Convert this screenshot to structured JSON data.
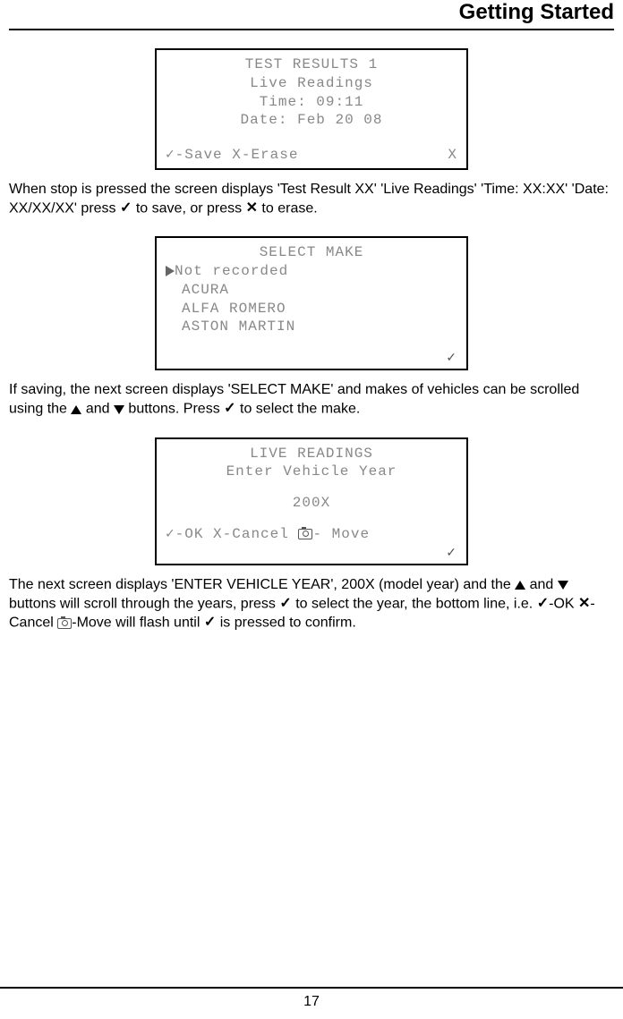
{
  "header": {
    "title": "Getting Started"
  },
  "lcd1": {
    "l1": "TEST RESULTS 1",
    "l2": "Live Readings",
    "l3": "Time: 09:11",
    "l4": "Date: Feb 20 08",
    "footer_left": "✓-Save   X-Erase",
    "footer_right": "X"
  },
  "para1": {
    "t1": "When stop is pressed the screen displays 'Test Result XX' 'Live Readings' 'Time: XX:XX' 'Date: XX/XX/XX' press ",
    "t2": " to save, or press ",
    "t3": " to erase."
  },
  "lcd2": {
    "title": "SELECT MAKE",
    "item0": "Not recorded",
    "item1": "ACURA",
    "item2": "ALFA ROMERO",
    "item3": "ASTON MARTIN",
    "footer": "✓"
  },
  "para2": {
    "t1": "If saving, the next screen displays 'SELECT MAKE' and makes of vehicles can be scrolled using the ",
    "t2": " and ",
    "t3": " buttons. Press ",
    "t4": " to select the make."
  },
  "lcd3": {
    "l1": "LIVE READINGS",
    "l2": "Enter Vehicle Year",
    "l3": "200X",
    "footer_left1": "✓-OK X-Cancel ",
    "footer_left2": "- Move",
    "footer_right": "✓"
  },
  "para3": {
    "t1": "The next screen displays 'ENTER VEHICLE YEAR', 200X (model year) and the ",
    "t2": " and ",
    "t3": " buttons will scroll through the years, press ",
    "t4": " to select the year, the bottom line, i.e. ",
    "t5": "-OK  ",
    "t6": "-Cancel ",
    "t7": "-Move will flash until ",
    "t8": " is pressed to confirm."
  },
  "footer": {
    "page": "17"
  }
}
